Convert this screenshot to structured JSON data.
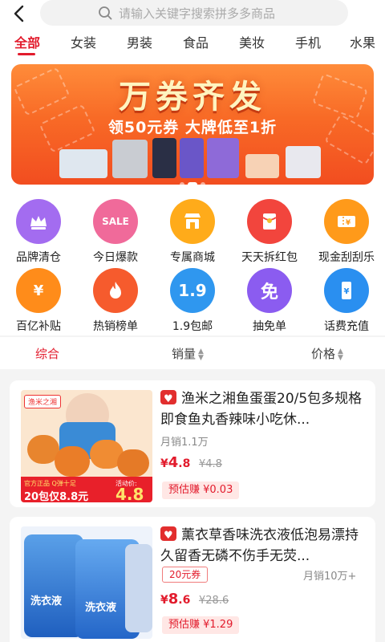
{
  "search": {
    "placeholder": "请输入关键字搜索拼多多商品"
  },
  "tabs": [
    "全部",
    "女装",
    "男装",
    "食品",
    "美妆",
    "手机",
    "水果"
  ],
  "banner": {
    "title": "万券齐发",
    "subtitle": "领50元券 大牌低至1折"
  },
  "shortcuts": [
    {
      "label": "品牌清仓",
      "icon": "crown-icon",
      "color": "#a36cf0",
      "glyph": ""
    },
    {
      "label": "今日爆款",
      "icon": "sale-icon",
      "color": "#f06a9a",
      "glyph": "SALE"
    },
    {
      "label": "专属商城",
      "icon": "store-icon",
      "color": "#ffab1a",
      "glyph": ""
    },
    {
      "label": "天天拆红包",
      "icon": "red-envelope-icon",
      "color": "#f2453d",
      "glyph": ""
    },
    {
      "label": "现金刮刮乐",
      "icon": "ticket-icon",
      "color": "#ff9a1a",
      "glyph": ""
    },
    {
      "label": "百亿补贴",
      "icon": "money-bag-icon",
      "color": "#ff8c1a",
      "glyph": "¥"
    },
    {
      "label": "热销榜单",
      "icon": "flame-icon",
      "color": "#f65b2d",
      "glyph": ""
    },
    {
      "label": "1.9包邮",
      "icon": "badge-1-9-icon",
      "color": "#2f97ef",
      "glyph": "1.9"
    },
    {
      "label": "抽免单",
      "icon": "free-order-icon",
      "color": "#8b5cf0",
      "glyph": "免"
    },
    {
      "label": "话费充值",
      "icon": "phone-topup-icon",
      "color": "#2a8ff0",
      "glyph": ""
    }
  ],
  "sort": {
    "overall": "综合",
    "sales": "销量",
    "price": "价格"
  },
  "products": [
    {
      "title": "渔米之湘鱼蛋蛋20/5包多规格即食鱼丸香辣味小吃休...",
      "sales": "月销1.1万",
      "price_int": "4",
      "price_dec": ".8",
      "orig": "¥4.8",
      "earn": "预估赚 ¥0.03",
      "thumb_brand": "渔米之湘",
      "thumb_badge": "官方正品 Q弹十足",
      "thumb_price": "20包仅8.8元",
      "thumb_right": "活动价:",
      "thumb_rprice": "4.8"
    },
    {
      "title": "薰衣草香味洗衣液低泡易漂持久留香无磷不伤手无荧...",
      "coupon": "20元券",
      "sales": "月销10万+",
      "price_int": "8",
      "price_dec": ".6",
      "orig": "¥28.6",
      "earn": "预估赚 ¥1.29",
      "thumb_text": "洗衣液",
      "thumb_text2": "洗衣液"
    }
  ],
  "currency": "¥",
  "colors": {
    "accent": "#e21b2c",
    "earn_bg": "#ffe7e5"
  }
}
